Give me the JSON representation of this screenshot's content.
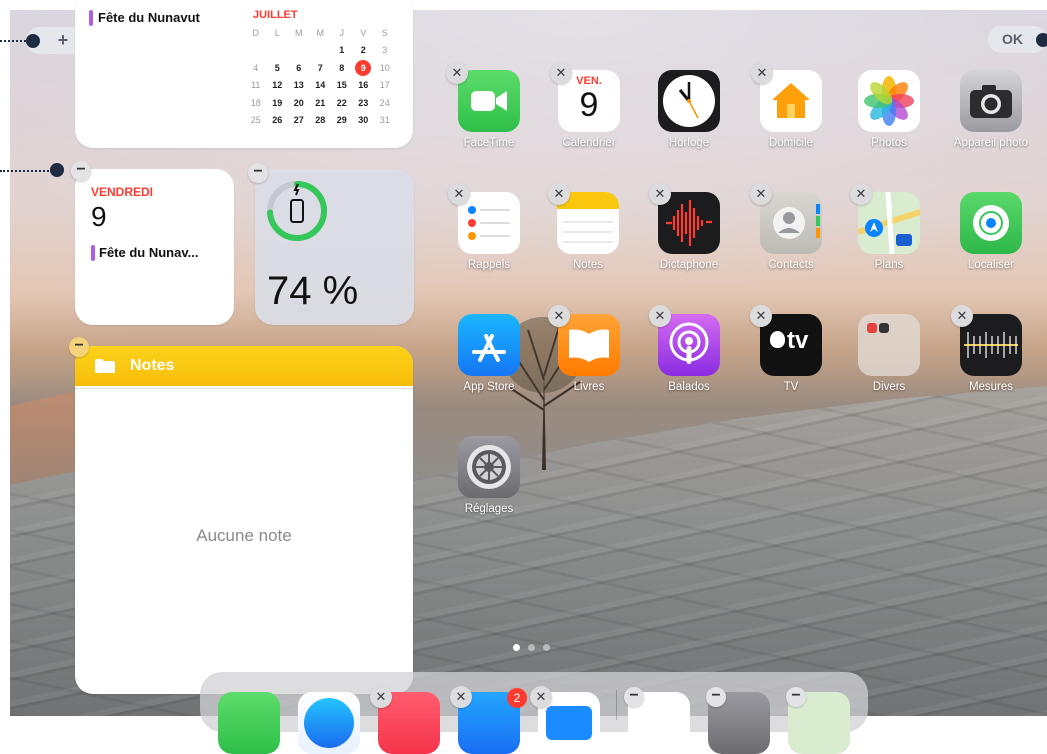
{
  "top_buttons": {
    "add_label": "+",
    "done_label": "OK"
  },
  "calendar_widget": {
    "event": "Fête du Nunavut",
    "month": "JUILLET",
    "weekdays": [
      "D",
      "L",
      "M",
      "M",
      "J",
      "V",
      "S"
    ],
    "weeks": [
      [
        "",
        "",
        "",
        "",
        "1",
        "2",
        "3"
      ],
      [
        "4",
        "5",
        "6",
        "7",
        "8",
        "9",
        "10"
      ],
      [
        "11",
        "12",
        "13",
        "14",
        "15",
        "16",
        "17"
      ],
      [
        "18",
        "19",
        "20",
        "21",
        "22",
        "23",
        "24"
      ],
      [
        "25",
        "26",
        "27",
        "28",
        "29",
        "30",
        "31"
      ]
    ],
    "today": "9"
  },
  "day_widget": {
    "weekday": "VENDREDI",
    "day": "9",
    "event": "Fête du Nunav..."
  },
  "battery_widget": {
    "percent_label": "74 %",
    "level": 0.74
  },
  "notes_widget": {
    "title": "Notes",
    "empty_label": "Aucune note"
  },
  "calendar_icon": {
    "weekday": "VEN.",
    "day": "9"
  },
  "apps_row1": [
    "FaceTime",
    "Calendrier",
    "Horloge",
    "Domicile",
    "Photos",
    "Appareil photo"
  ],
  "apps_row2": [
    "Rappels",
    "Notes",
    "Dictaphone",
    "Contacts",
    "Plans",
    "Localiser"
  ],
  "apps_row3": [
    "App Store",
    "Livres",
    "Balados",
    "TV",
    "Divers",
    "Mesures"
  ],
  "apps_row4": [
    "Réglages"
  ],
  "tv_icon_text": "tv",
  "page_dots": {
    "count": 3,
    "active": 0
  },
  "dock": {
    "mail_badge": "2"
  },
  "colors": {
    "accent_red": "#ff3b30",
    "notes_yellow": "#f9c80e",
    "calendar_bar": "#b15ee2",
    "battery_green": "#34c759"
  }
}
